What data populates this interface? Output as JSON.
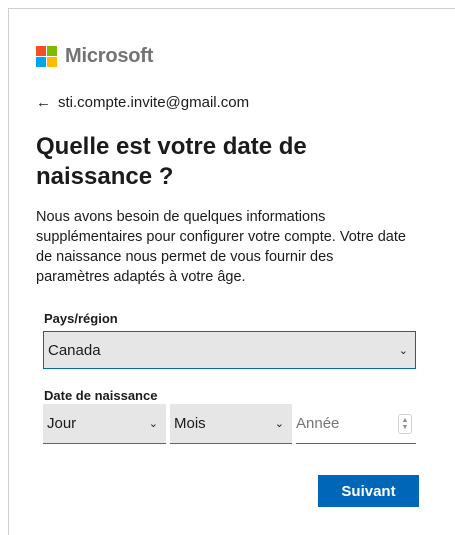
{
  "brand": {
    "name": "Microsoft",
    "logo_colors": [
      "#f25022",
      "#7fba00",
      "#00a4ef",
      "#ffb900"
    ]
  },
  "back": {
    "icon": "arrow-left-icon",
    "arrow": "←",
    "email": "sti.compte.invite@gmail.com"
  },
  "title": "Quelle est votre date de naissance ?",
  "description": "Nous avons besoin de quelques informations supplémentaires pour configurer votre compte. Votre date de naissance nous permet de vous fournir des paramètres adaptés à votre âge.",
  "country": {
    "label": "Pays/région",
    "value": "Canada",
    "chevron": "⌄"
  },
  "birthdate": {
    "label": "Date de naissance",
    "day_value": "Jour",
    "month_value": "Mois",
    "year_placeholder": "Année",
    "chevron": "⌄",
    "spinner_up": "▲",
    "spinner_down": "▼"
  },
  "next_button": {
    "label": "Suivant",
    "color": "#0067b8"
  }
}
